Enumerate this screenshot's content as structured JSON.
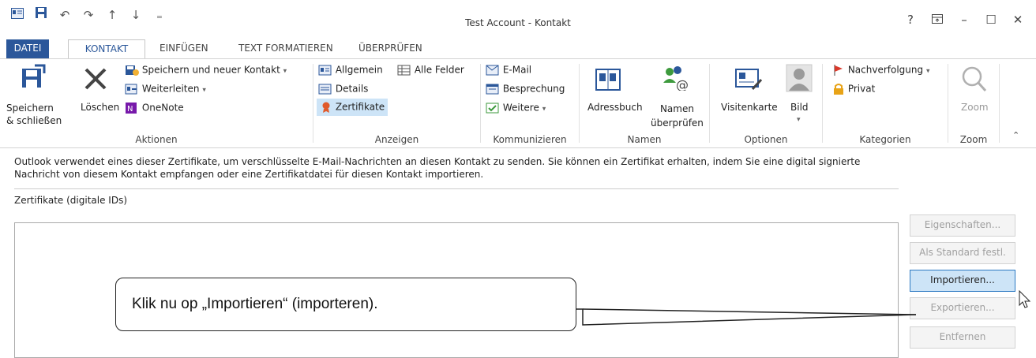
{
  "window": {
    "title": "Test Account - Kontakt",
    "help": "?",
    "controls": [
      "restore-ribbon",
      "minimize",
      "maximize",
      "close"
    ]
  },
  "tabs": {
    "datei": "DATEI",
    "kontakt": "KONTAKT",
    "einfuegen": "EINFÜGEN",
    "text_formatieren": "TEXT FORMATIEREN",
    "ueberpruefen": "ÜBERPRÜFEN"
  },
  "ribbon": {
    "aktionen": {
      "label": "Aktionen",
      "speichern_schliessen_line1": "Speichern",
      "speichern_schliessen_line2": "& schließen",
      "loeschen": "Löschen",
      "speichern_neuer_kontakt": "Speichern und neuer Kontakt",
      "weiterleiten": "Weiterleiten",
      "onenote": "OneNote"
    },
    "anzeigen": {
      "label": "Anzeigen",
      "allgemein": "Allgemein",
      "alle_felder": "Alle Felder",
      "details": "Details",
      "zertifikate": "Zertifikate"
    },
    "kommunizieren": {
      "label": "Kommunizieren",
      "email": "E-Mail",
      "besprechung": "Besprechung",
      "weitere": "Weitere"
    },
    "namen": {
      "label": "Namen",
      "adressbuch": "Adressbuch",
      "namen_line1": "Namen",
      "namen_line2": "überprüfen"
    },
    "optionen": {
      "label": "Optionen",
      "visitenkarte": "Visitenkarte",
      "bild": "Bild"
    },
    "kategorien": {
      "label": "Kategorien",
      "nachverfolgung": "Nachverfolgung",
      "privat": "Privat"
    },
    "zoom": {
      "label": "Zoom",
      "zoom": "Zoom"
    }
  },
  "content": {
    "info_text": "Outlook verwendet eines dieser Zertifikate, um verschlüsselte E-Mail-Nachrichten an diesen Kontakt zu senden. Sie können ein Zertifikat erhalten, indem Sie eine digital signierte Nachricht von diesem Kontakt empfangen oder eine Zertifikatdatei für diesen Kontakt importieren.",
    "zertifikate_label": "Zertifikate (digitale IDs)",
    "buttons": {
      "eigenschaften": "Eigenschaften...",
      "als_standard": "Als Standard festl.",
      "importieren": "Importieren...",
      "exportieren": "Exportieren...",
      "entfernen": "Entfernen"
    }
  },
  "callout": {
    "text": "Klik nu op „Importieren“ (importeren)."
  },
  "colors": {
    "accent": "#2b579a",
    "highlight": "#cde4f7"
  }
}
